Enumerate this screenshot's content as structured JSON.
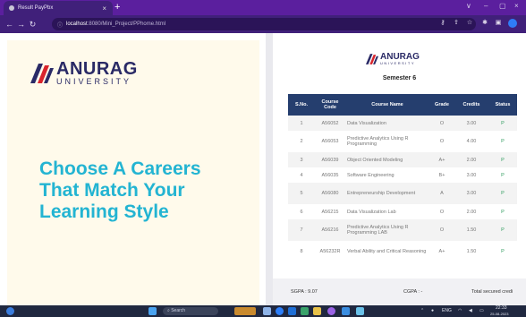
{
  "browser": {
    "tab_title": "Result PayPbx",
    "tab_close": "×",
    "new_tab": "+",
    "url_host": "localhost",
    "url_path": ":8080/Mini_Project/PPhome.html",
    "win_controls": [
      "∨",
      "–",
      "▢",
      "×"
    ]
  },
  "left": {
    "logo_big": "ANURAG",
    "logo_small": "UNIVERSITY",
    "headline_lines": [
      "Choose A Careers",
      "That Match Your",
      "Learning Style"
    ]
  },
  "right": {
    "logo_big": "ANURAG",
    "logo_small": "UNIVERSITY",
    "semester": "Semester 6",
    "columns": [
      "S.No.",
      "Course Code",
      "Course Name",
      "Grade",
      "Credits",
      "Status"
    ],
    "rows": [
      [
        "1",
        "A56052",
        "Data Visualization",
        "O",
        "3.00",
        "P"
      ],
      [
        "2",
        "A56053",
        "Predictive Analytics Using R Programming",
        "O",
        "4.00",
        "P"
      ],
      [
        "3",
        "A56039",
        "Object Oriented Modeling",
        "A+",
        "2.00",
        "P"
      ],
      [
        "4",
        "A56035",
        "Software Engineering",
        "B+",
        "3.00",
        "P"
      ],
      [
        "5",
        "A56080",
        "Entrepreneurship Development",
        "A",
        "3.00",
        "P"
      ],
      [
        "6",
        "A56215",
        "Data Visualization Lab",
        "O",
        "2.00",
        "P"
      ],
      [
        "7",
        "A56216",
        "Predictive Analytics Using R Programming LAB",
        "O",
        "1.50",
        "P"
      ],
      [
        "8",
        "A56232R",
        "Verbal Ability and Critical Reasoning",
        "A+",
        "1.50",
        "P"
      ]
    ],
    "sgpa": "SGPA : 9.07",
    "cgpa": "CGPA : -",
    "total_credits": "Total secured credi"
  },
  "taskbar": {
    "search_label": "Search",
    "lang": "ENG",
    "time": "22:33",
    "date": "25-08-2023"
  },
  "colors": {
    "browser_frame": "#5b1f9e",
    "headline": "#23b4d2",
    "table_header": "#253e6e",
    "status_pass": "#2f9c5e"
  }
}
